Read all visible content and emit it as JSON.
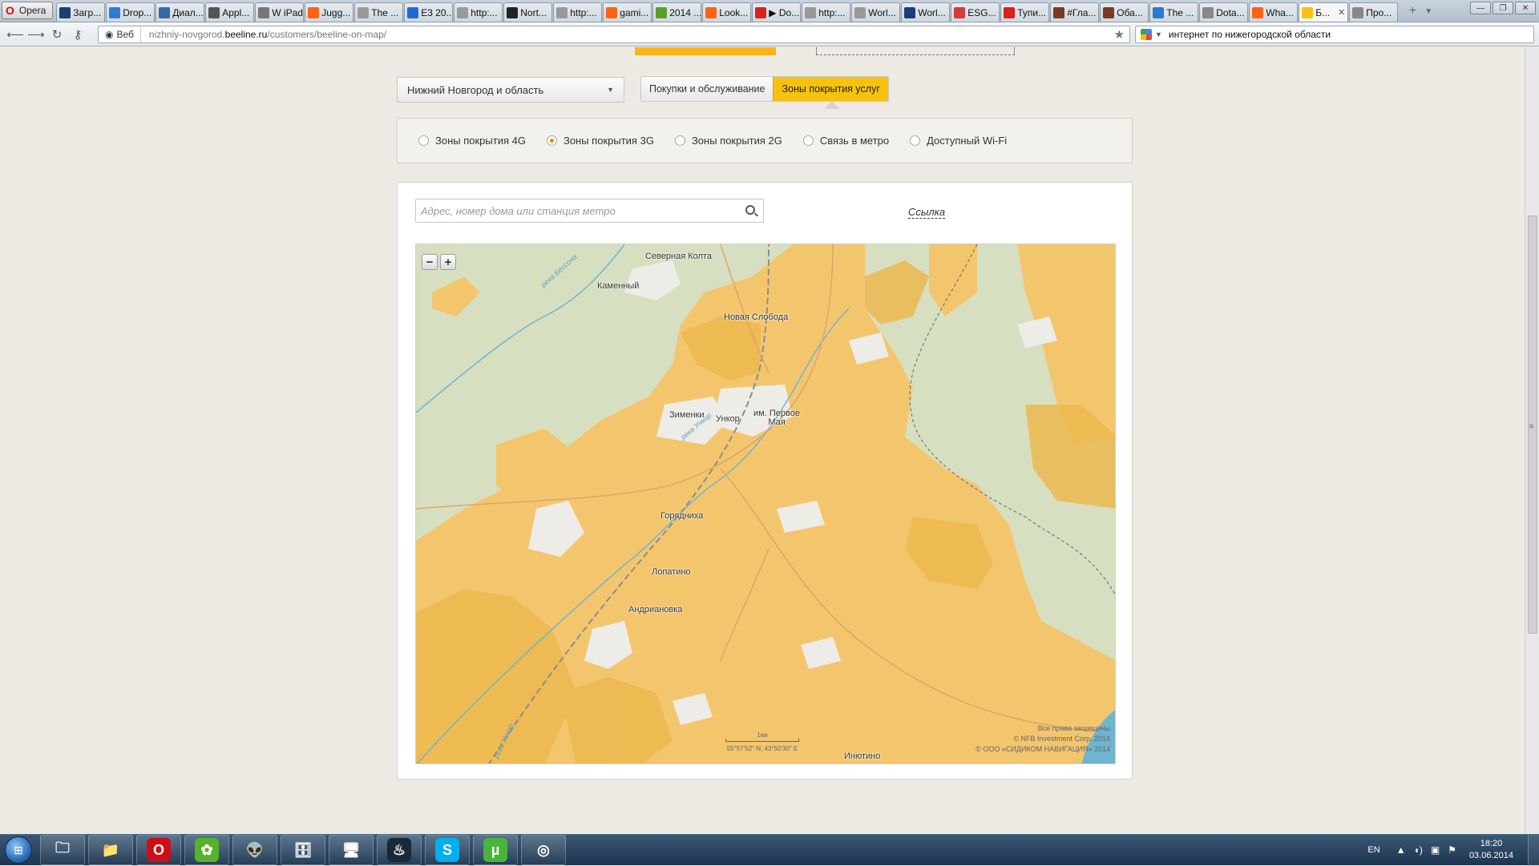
{
  "browser": {
    "menu_label": "Opera",
    "tabs": [
      {
        "label": "Загр...",
        "icon": "download-tab-icon",
        "color": "#1b3f6e"
      },
      {
        "label": "Drop...",
        "icon": "dropbox-tab-icon",
        "color": "#2d7cd3"
      },
      {
        "label": "Диал...",
        "icon": "chat-tab-icon",
        "color": "#3569a8"
      },
      {
        "label": "Appl...",
        "icon": "apple-tab-icon",
        "color": "#555555"
      },
      {
        "label": "W iPad ...",
        "icon": "wikipedia-tab-icon",
        "color": "#777777"
      },
      {
        "label": "Jugg...",
        "icon": "reddit-tab-icon",
        "color": "#ff6314"
      },
      {
        "label": "The ...",
        "icon": "page-tab-icon",
        "color": "#999999"
      },
      {
        "label": "E3 20...",
        "icon": "e3-tab-icon",
        "color": "#1d6ad2"
      },
      {
        "label": "http:...",
        "icon": "page-tab-icon",
        "color": "#999999"
      },
      {
        "label": "Nort...",
        "icon": "d-tab-icon",
        "color": "#222222"
      },
      {
        "label": "http:...",
        "icon": "page-tab-icon",
        "color": "#999999"
      },
      {
        "label": "gami...",
        "icon": "reddit-tab-icon",
        "color": "#ff6314"
      },
      {
        "label": "2014 ...",
        "icon": "green-tab-icon",
        "color": "#5a9e2a"
      },
      {
        "label": "Look...",
        "icon": "reddit-tab-icon",
        "color": "#ff6314"
      },
      {
        "label": "▶ Do...",
        "icon": "youtube-tab-icon",
        "color": "#d9221c"
      },
      {
        "label": "http:...",
        "icon": "page-tab-icon",
        "color": "#999999"
      },
      {
        "label": "Worl...",
        "icon": "page-tab-icon",
        "color": "#999999"
      },
      {
        "label": "Worl...",
        "icon": "bi-tab-icon",
        "color": "#1a3f7a"
      },
      {
        "label": "ESG...",
        "icon": "esg-tab-icon",
        "color": "#d23c3c"
      },
      {
        "label": "Тупи...",
        "icon": "yandex-tab-icon",
        "color": "#d9221c"
      },
      {
        "label": "#Гла...",
        "icon": "book-tab-icon",
        "color": "#7a3a22"
      },
      {
        "label": "Оба...",
        "icon": "book-tab-icon",
        "color": "#7a3a22"
      },
      {
        "label": "The ...",
        "icon": "ie-tab-icon",
        "color": "#2a7bd3"
      },
      {
        "label": "Dota...",
        "icon": "loading-tab-icon",
        "color": "#888888"
      },
      {
        "label": "Wha...",
        "icon": "reddit-tab-icon",
        "color": "#ff6314"
      },
      {
        "label": "Б...",
        "icon": "beeline-tab-icon",
        "color": "#f6c20f",
        "active": true
      },
      {
        "label": "Про...",
        "icon": "loading-tab-icon",
        "color": "#888888"
      }
    ],
    "url_prefix_label": "Веб",
    "url_host_pre": "nizhniy-novgorod.",
    "url_host": "beeline.ru",
    "url_path": "/customers/beeline-on-map/",
    "search_query": "интернет по нижегородской области"
  },
  "page": {
    "region_select": "Нижний Новгород и область",
    "toggle": {
      "purchases": "Покупки и обслуживание",
      "coverage": "Зоны покрытия услуг"
    },
    "coverage_options": [
      {
        "label": "Зоны покрытия 4G",
        "selected": false
      },
      {
        "label": "Зоны покрытия 3G",
        "selected": true
      },
      {
        "label": "Зоны покрытия 2G",
        "selected": false
      },
      {
        "label": "Связь в метро",
        "selected": false
      },
      {
        "label": "Доступный Wi-Fi",
        "selected": false
      }
    ],
    "address_placeholder": "Адрес, номер дома или станция метро",
    "link_label": "Ссылка"
  },
  "map": {
    "zoom_out": "−",
    "zoom_in": "+",
    "places": [
      "Северная Колта",
      "Каменный",
      "Новая Слобода",
      "Зименки",
      "Ункор",
      "им. Первое Мая",
      "Горядниха",
      "Лопатино",
      "Андриановка",
      "Инютино"
    ],
    "rivers": [
      "река Бессона",
      "река Ункор",
      "река Ункор"
    ],
    "scale_label": "1км",
    "coords": "55°57'52\" N, 43°50'30\" E",
    "copyright": [
      "Все права защищены",
      "© NFB Investment Corp. 2014",
      "© ООО «СИДИКОМ НАВИГАЦИЯ» 2014"
    ],
    "colors": {
      "land": "#d7dfc1",
      "coverage": "#f3c66e",
      "coverage_dark": "#ecb94f",
      "settlement": "#eeece7",
      "water": "#6fb5cf"
    }
  },
  "taskbar": {
    "apps": [
      "explorer-icon",
      "folder-icon",
      "opera-icon",
      "icq-icon",
      "alien-icon",
      "archive-icon",
      "monitor-icon",
      "steam-icon",
      "skype-icon",
      "utorrent-icon",
      "disc-icon"
    ],
    "language": "EN",
    "time": "18:20",
    "date": "03.06.2014"
  }
}
